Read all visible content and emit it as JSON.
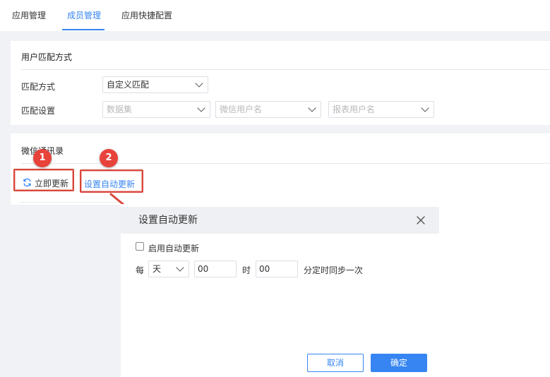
{
  "tabs": [
    {
      "label": "应用管理"
    },
    {
      "label": "成员管理"
    },
    {
      "label": "应用快捷配置"
    }
  ],
  "match_panel": {
    "title": "用户匹配方式",
    "method_label": "匹配方式",
    "method_value": "自定义匹配",
    "setting_label": "匹配设置",
    "dataset_placeholder": "数据集",
    "wechat_user_placeholder": "微信用户名",
    "report_user_placeholder": "报表用户名"
  },
  "contacts_panel": {
    "title": "微信通讯录",
    "refresh_button": "立即更新",
    "auto_update_button": "设置自动更新"
  },
  "callouts": [
    "1",
    "2"
  ],
  "dialog": {
    "title": "设置自动更新",
    "enable_label": "启用自动更新",
    "every_label": "每",
    "period_value": "天",
    "hour_value": "00",
    "hour_label": "时",
    "minute_value": "00",
    "minute_suffix": "分定时同步一次",
    "cancel_button": "取消",
    "ok_button": "确定"
  },
  "colors": {
    "accent": "#3685f2",
    "callout": "#e8433b",
    "highlight_border": "#d9453b"
  }
}
